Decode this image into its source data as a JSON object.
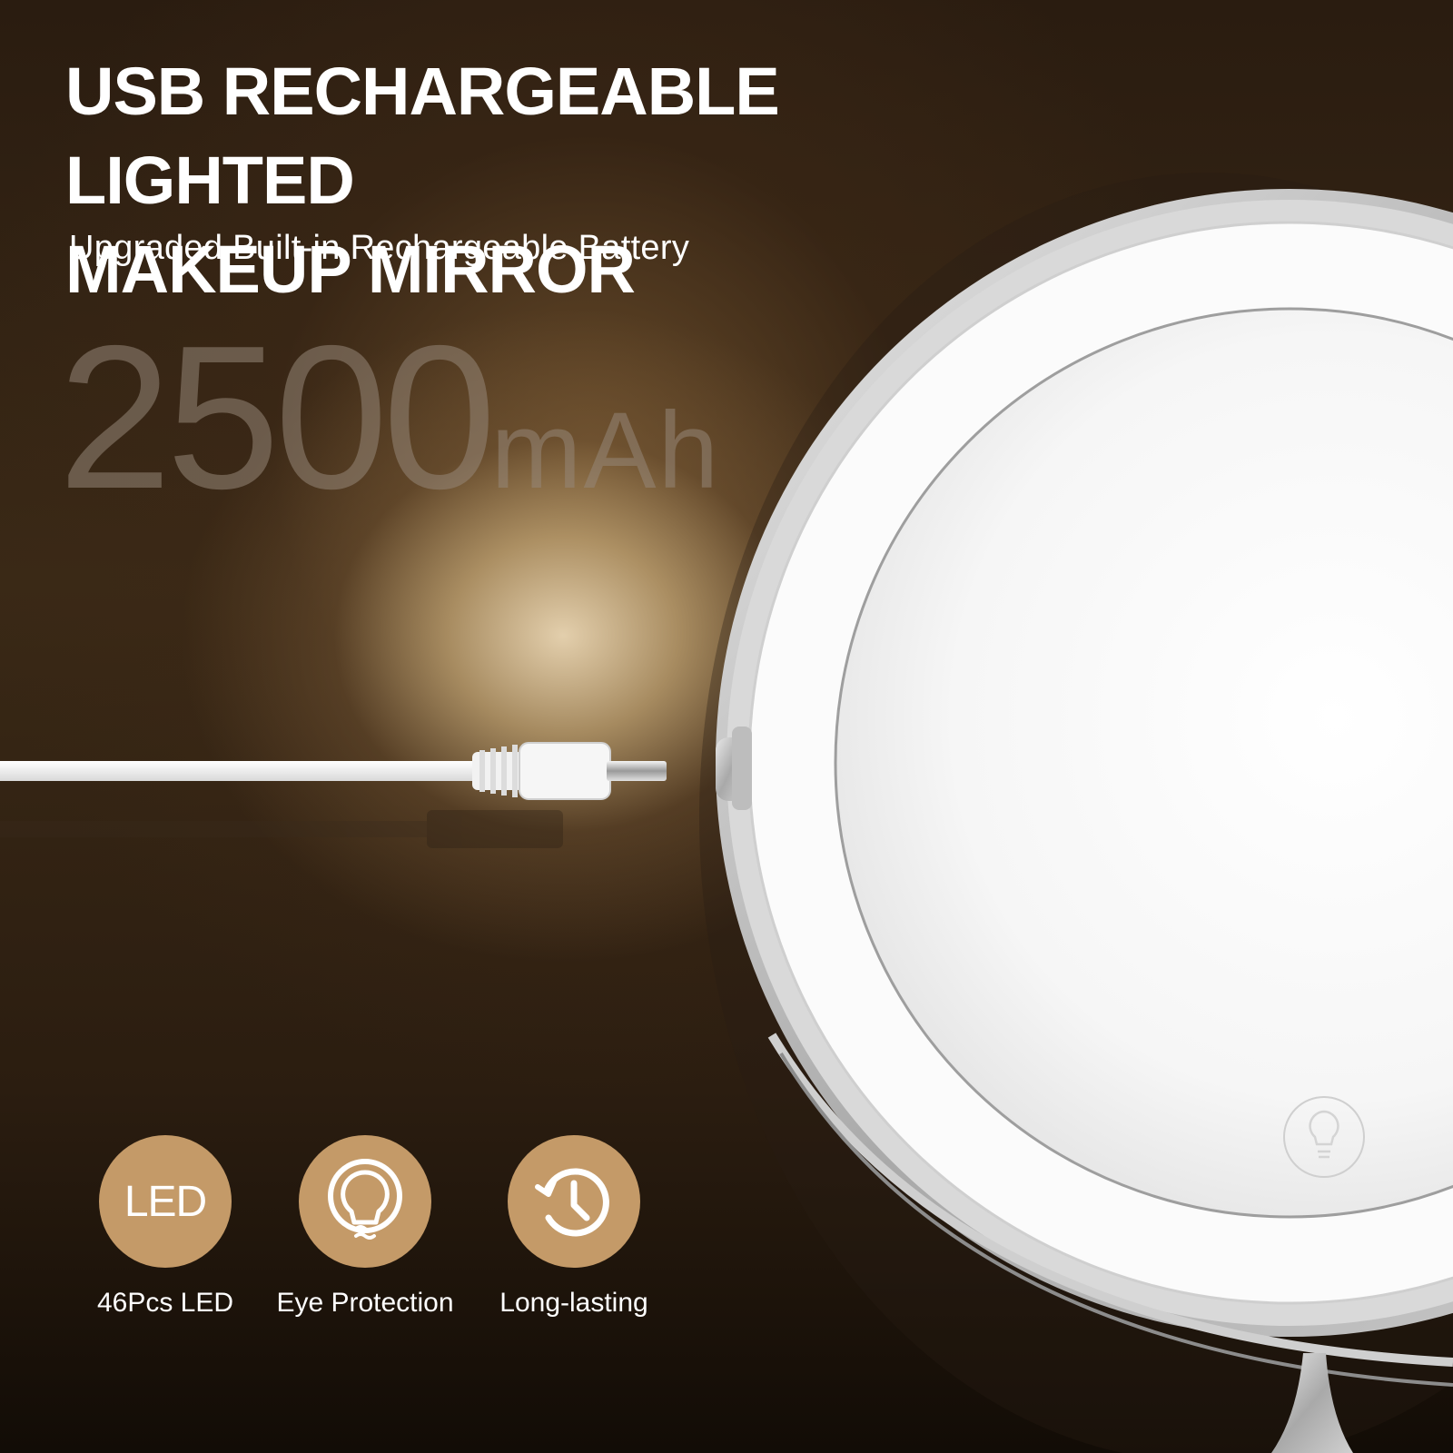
{
  "headline": {
    "line1": "USB RECHARGEABLE LIGHTED",
    "line2": "MAKEUP MIRROR"
  },
  "subtitle": "Upgraded Built-in Rechargeable Battery",
  "capacity": {
    "number": "2500",
    "unit": "mAh"
  },
  "features": [
    {
      "icon_text": "LED",
      "label": "46Pcs LED"
    },
    {
      "icon": "bulb-icon",
      "label": "Eye Protection"
    },
    {
      "icon": "clock-icon",
      "label": "Long-lasting"
    }
  ],
  "colors": {
    "feature_circle": "#c49a68",
    "text": "#ffffff"
  }
}
